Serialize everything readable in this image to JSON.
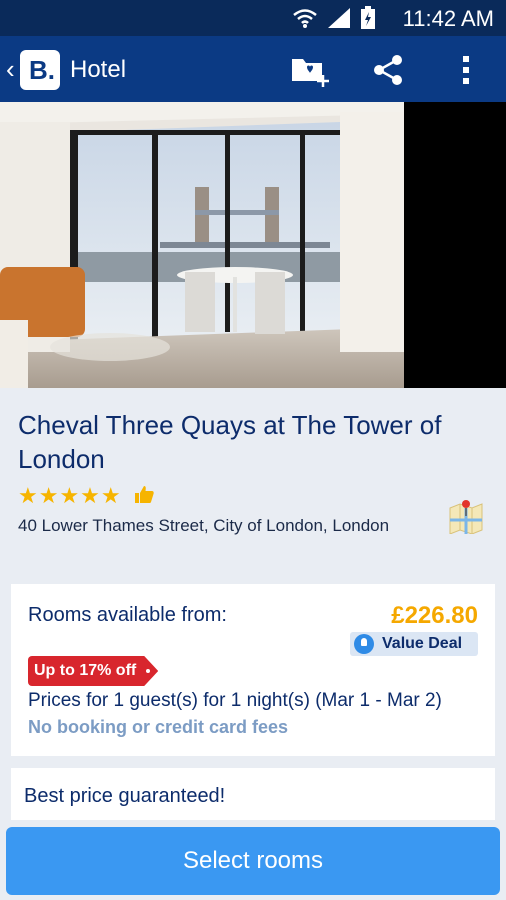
{
  "status_bar": {
    "time": "11:42 AM",
    "icons": [
      "wifi-icon",
      "signal-icon",
      "battery-icon"
    ]
  },
  "app_bar": {
    "title": "Hotel",
    "logo_text": "B.",
    "actions": [
      "add-to-list-icon",
      "share-icon",
      "more-icon"
    ]
  },
  "hotel": {
    "name": "Cheval Three Quays at The Tower of London",
    "stars": "★★★★★",
    "star_rating": 5,
    "address": "40 Lower Thames Street, City of London, London"
  },
  "availability": {
    "label": "Rooms available from:",
    "price": "£226.80",
    "deal_label": "Value Deal",
    "discount": "Up to 17% off",
    "prices_for": "Prices for 1 guest(s) for 1 night(s) (Mar 1 - Mar 2)",
    "fees_note": "No booking or credit card fees"
  },
  "promo": {
    "best_price": "Best price guaranteed!"
  },
  "cta": {
    "select_rooms": "Select rooms"
  },
  "colors": {
    "brand_navy": "#0b3a84",
    "price_orange": "#f5a800",
    "cta_blue": "#3a98f2",
    "discount_red": "#d8262d"
  }
}
